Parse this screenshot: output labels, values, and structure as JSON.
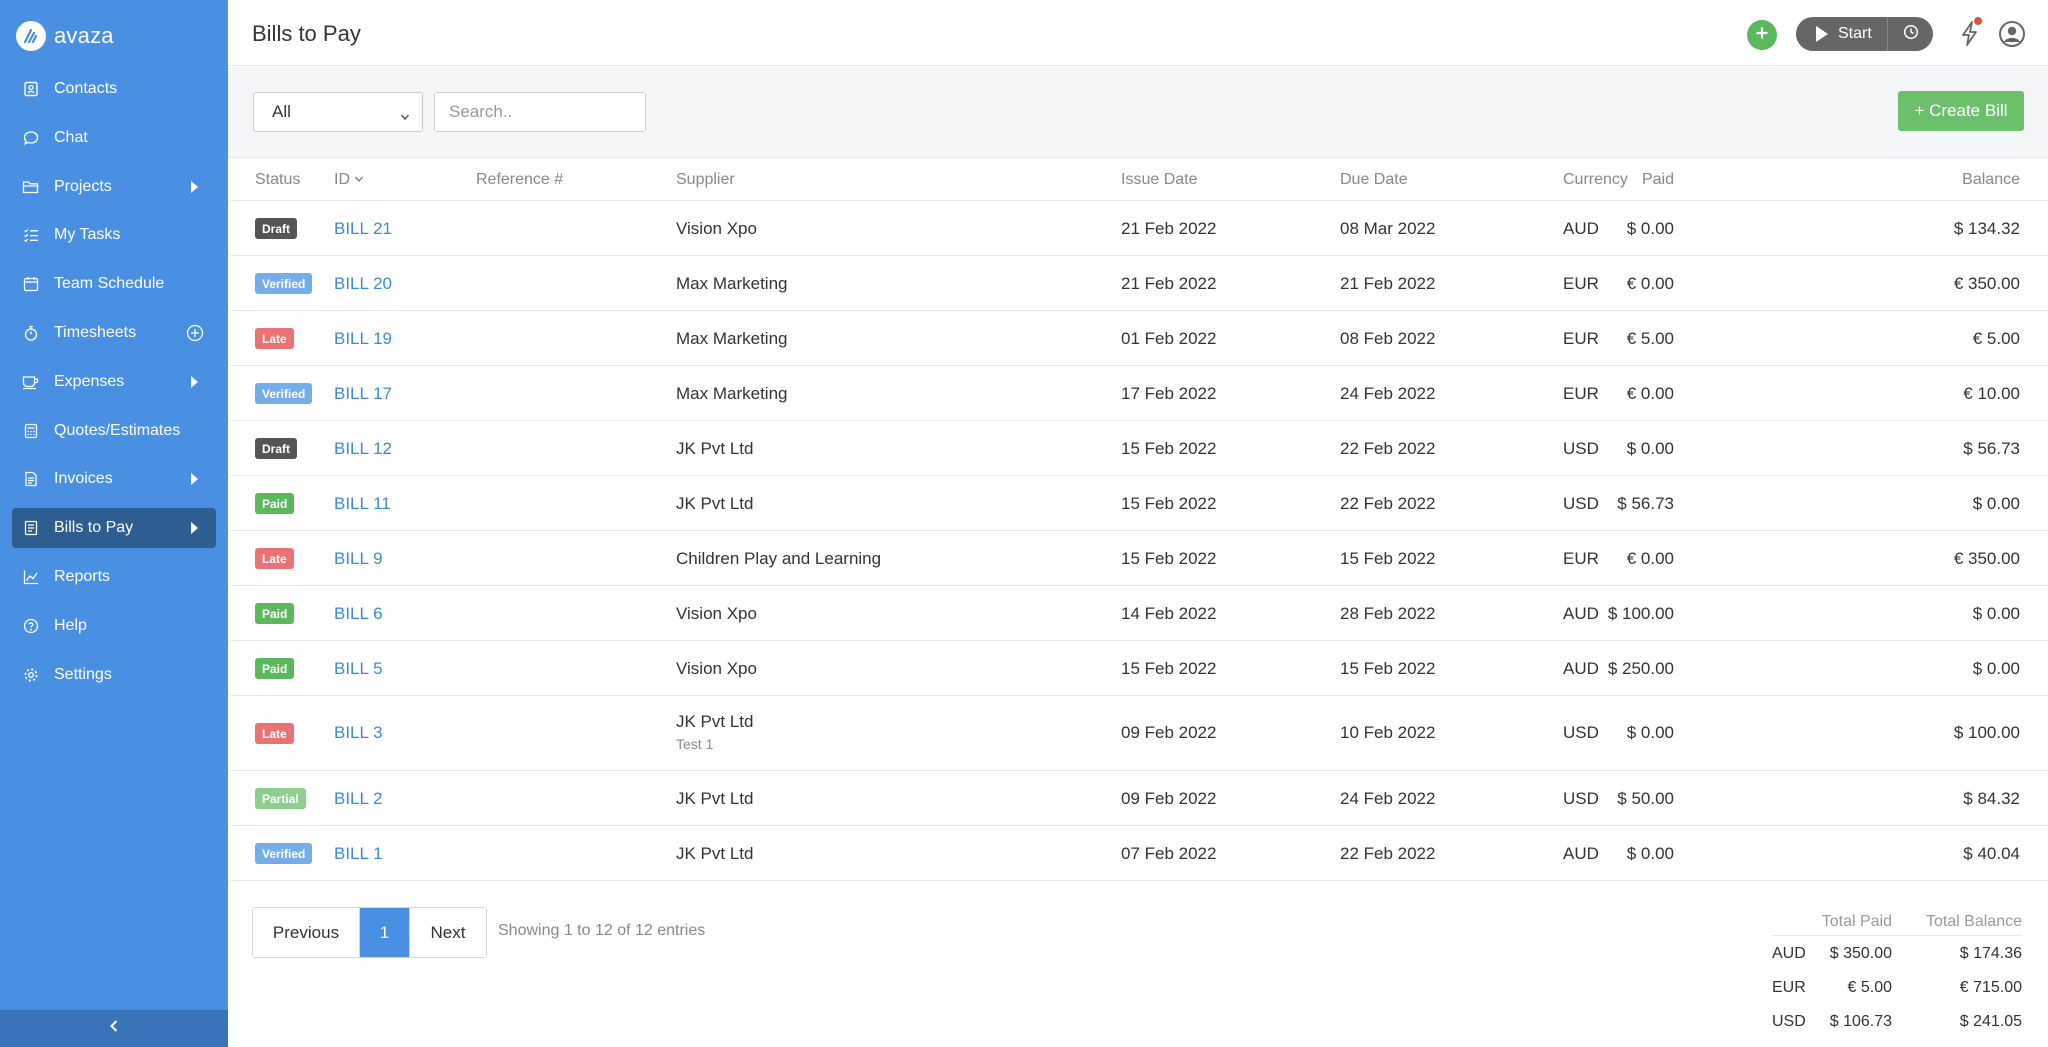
{
  "app": {
    "brand": "avaza"
  },
  "sidebar": {
    "items": [
      {
        "label": "Contacts",
        "icon": "contacts-icon"
      },
      {
        "label": "Chat",
        "icon": "chat-icon"
      },
      {
        "label": "Projects",
        "icon": "folder-icon"
      },
      {
        "label": "My Tasks",
        "icon": "tasks-icon"
      },
      {
        "label": "Team Schedule",
        "icon": "calendar-icon"
      },
      {
        "label": "Timesheets",
        "icon": "stopwatch-icon"
      },
      {
        "label": "Expenses",
        "icon": "cup-icon"
      },
      {
        "label": "Quotes/Estimates",
        "icon": "calculator-icon"
      },
      {
        "label": "Invoices",
        "icon": "invoice-icon"
      },
      {
        "label": "Bills to Pay",
        "icon": "bill-icon"
      },
      {
        "label": "Reports",
        "icon": "chart-icon"
      },
      {
        "label": "Help",
        "icon": "help-icon"
      },
      {
        "label": "Settings",
        "icon": "gear-icon"
      }
    ]
  },
  "header": {
    "title": "Bills to Pay",
    "timer_label": "Start"
  },
  "toolbar": {
    "filter_value": "All",
    "search_placeholder": "Search..",
    "create_label": "+ Create Bill"
  },
  "table": {
    "columns": [
      "Status",
      "ID",
      "Reference #",
      "Supplier",
      "Issue Date",
      "Due Date",
      "Currency",
      "Paid",
      "Balance"
    ],
    "rows": [
      {
        "status": "Draft",
        "id": "BILL 21",
        "supplier": "Vision Xpo",
        "note": "",
        "issue": "21 Feb 2022",
        "due": "08 Mar 2022",
        "currency": "AUD",
        "paid": "$ 0.00",
        "balance": "$ 134.32"
      },
      {
        "status": "Verified",
        "id": "BILL 20",
        "supplier": "Max Marketing",
        "note": "",
        "issue": "21 Feb 2022",
        "due": "21 Feb 2022",
        "currency": "EUR",
        "paid": "€ 0.00",
        "balance": "€ 350.00"
      },
      {
        "status": "Late",
        "id": "BILL 19",
        "supplier": "Max Marketing",
        "note": "",
        "issue": "01 Feb 2022",
        "due": "08 Feb 2022",
        "currency": "EUR",
        "paid": "€ 5.00",
        "balance": "€ 5.00"
      },
      {
        "status": "Verified",
        "id": "BILL 17",
        "supplier": "Max Marketing",
        "note": "",
        "issue": "17 Feb 2022",
        "due": "24 Feb 2022",
        "currency": "EUR",
        "paid": "€ 0.00",
        "balance": "€ 10.00"
      },
      {
        "status": "Draft",
        "id": "BILL 12",
        "supplier": "JK Pvt Ltd",
        "note": "",
        "issue": "15 Feb 2022",
        "due": "22 Feb 2022",
        "currency": "USD",
        "paid": "$ 0.00",
        "balance": "$ 56.73"
      },
      {
        "status": "Paid",
        "id": "BILL 11",
        "supplier": "JK Pvt Ltd",
        "note": "",
        "issue": "15 Feb 2022",
        "due": "22 Feb 2022",
        "currency": "USD",
        "paid": "$ 56.73",
        "balance": "$ 0.00"
      },
      {
        "status": "Late",
        "id": "BILL 9",
        "supplier": "Children Play and Learning",
        "note": "",
        "issue": "15 Feb 2022",
        "due": "15 Feb 2022",
        "currency": "EUR",
        "paid": "€ 0.00",
        "balance": "€ 350.00"
      },
      {
        "status": "Paid",
        "id": "BILL 6",
        "supplier": "Vision Xpo",
        "note": "",
        "issue": "14 Feb 2022",
        "due": "28 Feb 2022",
        "currency": "AUD",
        "paid": "$ 100.00",
        "balance": "$ 0.00"
      },
      {
        "status": "Paid",
        "id": "BILL 5",
        "supplier": "Vision Xpo",
        "note": "",
        "issue": "15 Feb 2022",
        "due": "15 Feb 2022",
        "currency": "AUD",
        "paid": "$ 250.00",
        "balance": "$ 0.00"
      },
      {
        "status": "Late",
        "id": "BILL 3",
        "supplier": "JK Pvt Ltd",
        "note": "Test 1",
        "issue": "09 Feb 2022",
        "due": "10 Feb 2022",
        "currency": "USD",
        "paid": "$ 0.00",
        "balance": "$ 100.00"
      },
      {
        "status": "Partial",
        "id": "BILL 2",
        "supplier": "JK Pvt Ltd",
        "note": "",
        "issue": "09 Feb 2022",
        "due": "24 Feb 2022",
        "currency": "USD",
        "paid": "$ 50.00",
        "balance": "$ 84.32"
      },
      {
        "status": "Verified",
        "id": "BILL 1",
        "supplier": "JK Pvt Ltd",
        "note": "",
        "issue": "07 Feb 2022",
        "due": "22 Feb 2022",
        "currency": "AUD",
        "paid": "$ 0.00",
        "balance": "$ 40.04"
      }
    ]
  },
  "pagination": {
    "previous": "Previous",
    "current": "1",
    "next": "Next",
    "showing": "Showing 1 to 12 of 12 entries"
  },
  "totals": {
    "paid_label": "Total Paid",
    "balance_label": "Total Balance",
    "rows": [
      {
        "currency": "AUD",
        "paid": "$ 350.00",
        "balance": "$ 174.36"
      },
      {
        "currency": "EUR",
        "paid": "€ 5.00",
        "balance": "€ 715.00"
      },
      {
        "currency": "USD",
        "paid": "$ 106.73",
        "balance": "$ 241.05"
      }
    ]
  },
  "colors": {
    "sidebar": "#4a90e2",
    "sidebar_active": "#2d5d91",
    "link": "#3b8bd4",
    "create_button": "#6cc06c",
    "badge_draft": "#555555",
    "badge_verified": "#75acea",
    "badge_late": "#ea7272",
    "badge_paid": "#5cb85c",
    "badge_partial": "#8fce8f"
  }
}
